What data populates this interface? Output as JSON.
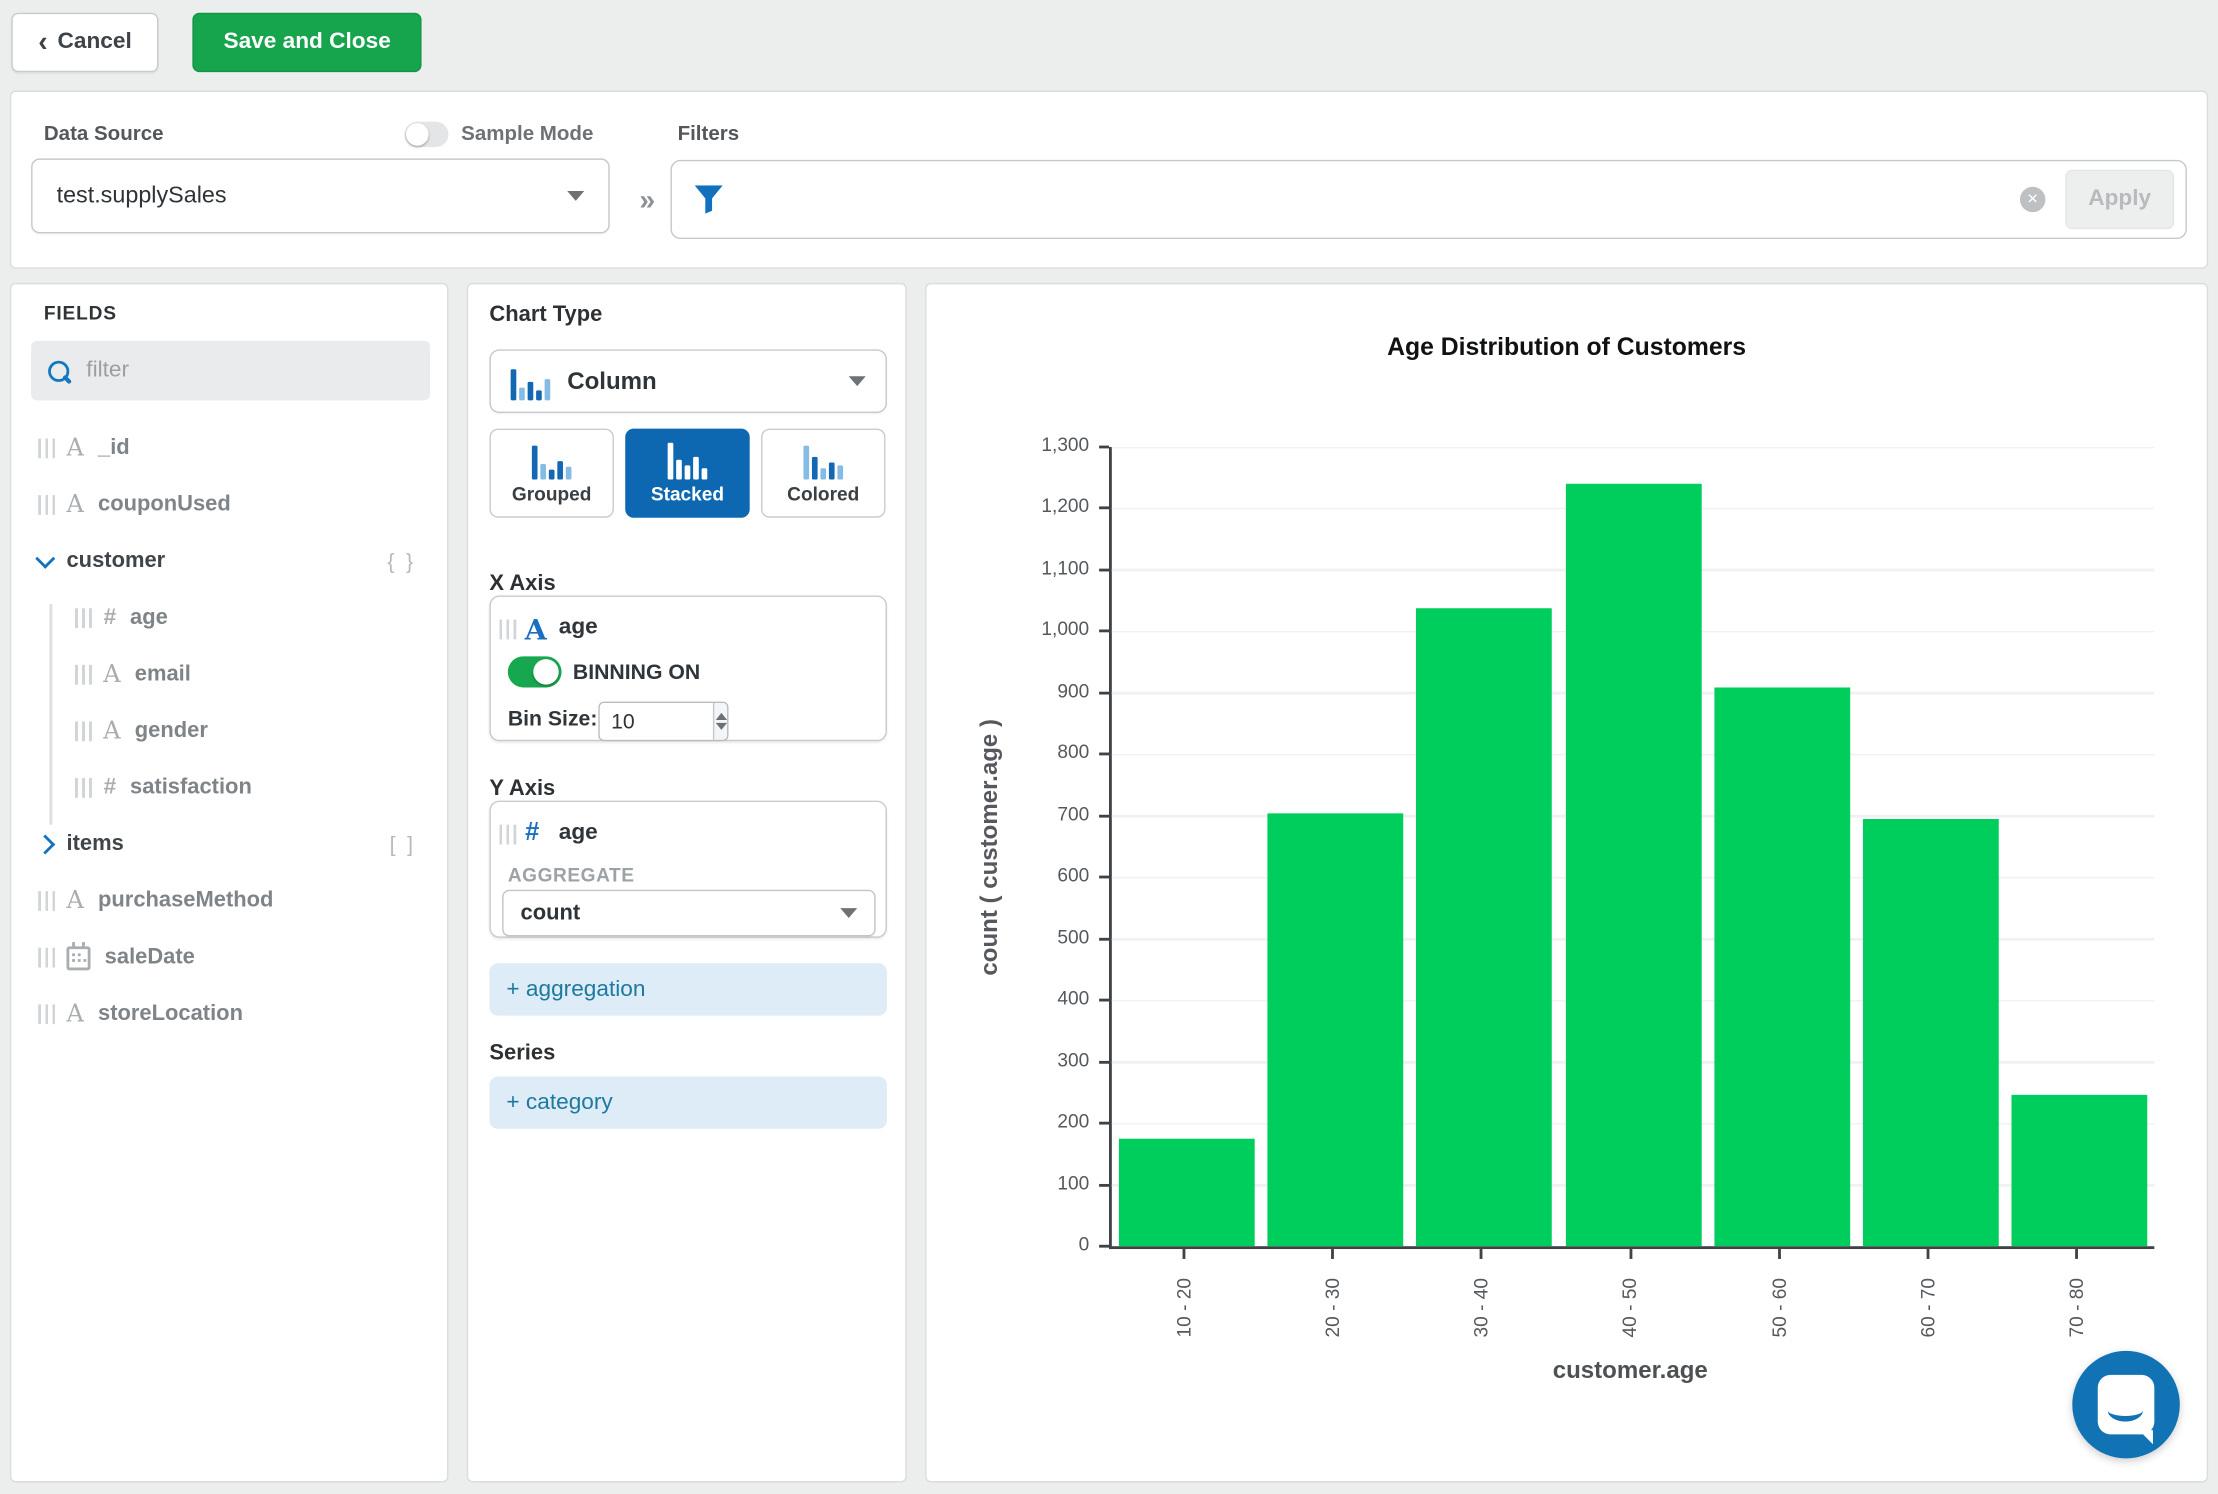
{
  "topbar": {
    "cancel_label": "Cancel",
    "save_label": "Save and Close"
  },
  "datasource": {
    "label": "Data Source",
    "value": "test.supplySales",
    "sample_mode_label": "Sample Mode",
    "sample_mode_on": false
  },
  "filters": {
    "label": "Filters",
    "apply_label": "Apply",
    "apply_enabled": false
  },
  "fields": {
    "title": "FIELDS",
    "filter_placeholder": "filter",
    "icon_map": {
      "string": "A",
      "number": "#",
      "date": "calendar-icon"
    },
    "items": [
      {
        "name": "_id",
        "type": "string"
      },
      {
        "name": "couponUsed",
        "type": "string"
      },
      {
        "name": "customer",
        "type": "object",
        "expanded": true,
        "badge": "{ }"
      },
      {
        "name": "age",
        "type": "number",
        "child": true
      },
      {
        "name": "email",
        "type": "string",
        "child": true
      },
      {
        "name": "gender",
        "type": "string",
        "child": true
      },
      {
        "name": "satisfaction",
        "type": "number",
        "child": true
      },
      {
        "name": "items",
        "type": "array",
        "expanded": false,
        "badge": "[ ]"
      },
      {
        "name": "purchaseMethod",
        "type": "string"
      },
      {
        "name": "saleDate",
        "type": "date"
      },
      {
        "name": "storeLocation",
        "type": "string"
      }
    ]
  },
  "encode": {
    "chart_type_label": "Chart Type",
    "chart_type_value": "Column",
    "variants": [
      {
        "label": "Grouped",
        "selected": false
      },
      {
        "label": "Stacked",
        "selected": true
      },
      {
        "label": "Colored",
        "selected": false
      }
    ],
    "x_axis": {
      "label": "X Axis",
      "field": "age",
      "field_type": "string",
      "binning_label": "BINNING ON",
      "binning_on": true,
      "bin_size_label": "Bin Size:",
      "bin_size": "10"
    },
    "y_axis": {
      "label": "Y Axis",
      "field": "age",
      "field_type": "number",
      "aggregate_label": "AGGREGATE",
      "aggregate_value": "count"
    },
    "add_aggregation_label": "+ aggregation",
    "series_label": "Series",
    "add_category_label": "+ category"
  },
  "chart_data": {
    "type": "bar",
    "title": "Age Distribution of Customers",
    "xlabel": "customer.age",
    "ylabel": "count ( customer.age )",
    "categories": [
      "10 - 20",
      "20 - 30",
      "30 - 40",
      "40 - 50",
      "50 - 60",
      "60 - 70",
      "70 - 80"
    ],
    "values": [
      175,
      703,
      1037,
      1240,
      910,
      695,
      246
    ],
    "ylim": [
      0,
      1300
    ],
    "ytick_step": 100,
    "ytick_labels": [
      "0",
      "100",
      "200",
      "300",
      "400",
      "500",
      "600",
      "700",
      "800",
      "900",
      "1,000",
      "1,100",
      "1,200",
      "1,300"
    ],
    "grid": true,
    "legend": "none",
    "bar_color": "#00ce5c"
  },
  "colors": {
    "button_green": "#16a44d",
    "toggle_green": "#17a84f",
    "bar_green": "#00ce5c",
    "accent_blue": "#1372bf",
    "selected_blue": "#0d68b1",
    "pill_bg": "#ddecf7",
    "pill_text": "#1d7a9e",
    "intercom_blue": "#1173b4",
    "page_bg": "#eceeee"
  }
}
